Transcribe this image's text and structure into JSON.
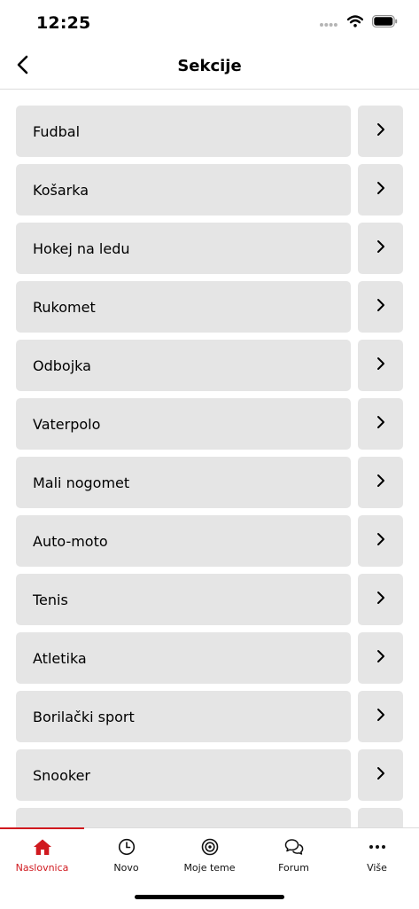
{
  "status_bar": {
    "time": "12:25",
    "icons": [
      "signal-dots-icon",
      "wifi-icon",
      "battery-icon"
    ]
  },
  "nav": {
    "title": "Sekcije",
    "back_icon": "chevron-left-icon"
  },
  "sections": [
    {
      "label": "Fudbal"
    },
    {
      "label": "Košarka"
    },
    {
      "label": "Hokej na ledu"
    },
    {
      "label": "Rukomet"
    },
    {
      "label": "Odbojka"
    },
    {
      "label": "Vaterpolo"
    },
    {
      "label": "Mali nogomet"
    },
    {
      "label": "Auto-moto"
    },
    {
      "label": "Tenis"
    },
    {
      "label": "Atletika"
    },
    {
      "label": "Borilački sport"
    },
    {
      "label": "Snooker"
    },
    {
      "label": ""
    }
  ],
  "tabs": [
    {
      "label": "Naslovnica",
      "icon": "home-icon",
      "active": true
    },
    {
      "label": "Novo",
      "icon": "clock-icon",
      "active": false
    },
    {
      "label": "Moje teme",
      "icon": "target-icon",
      "active": false
    },
    {
      "label": "Forum",
      "icon": "chat-bubbles-icon",
      "active": false
    },
    {
      "label": "Više",
      "icon": "more-dots-icon",
      "active": false
    }
  ],
  "colors": {
    "accent": "#d0191f",
    "row_background": "#e5e5e5",
    "divider": "#dcdcdc"
  }
}
